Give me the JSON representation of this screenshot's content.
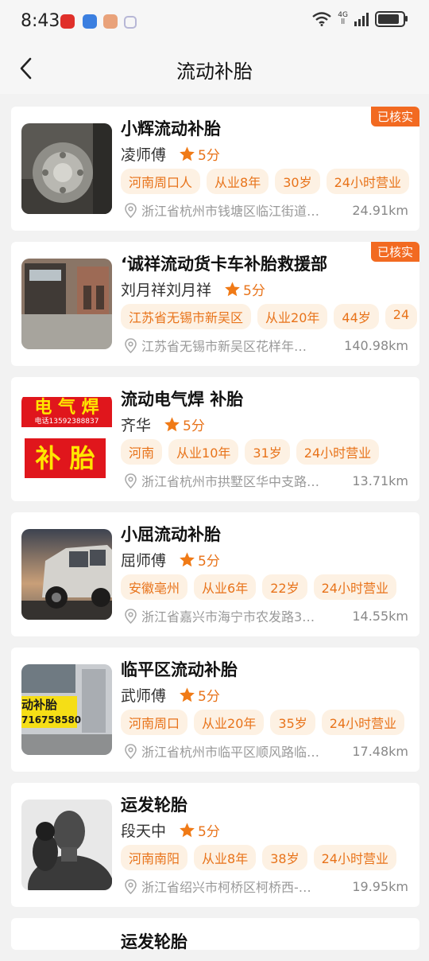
{
  "status": {
    "time": "8:43",
    "net_label_top": "4G",
    "net_label_bottom": "ll"
  },
  "header": {
    "title": "流动补胎"
  },
  "listings": [
    {
      "name": "小辉流动补胎",
      "person": "凌师傅",
      "score": "5分",
      "tags": [
        "河南周口人",
        "从业8年",
        "30岁",
        "24小时营业"
      ],
      "address": "浙江省杭州市钱塘区临江街道…",
      "distance": "24.91km",
      "badge": "已核实"
    },
    {
      "name": "‘诚祥流动货卡车补胎救援部",
      "person": "刘月祥刘月祥",
      "score": "5分",
      "tags": [
        "江苏省无锡市新吴区",
        "从业20年",
        "44岁",
        "24"
      ],
      "address": "江苏省无锡市新吴区花样年…",
      "distance": "140.98km",
      "badge": "已核实"
    },
    {
      "name": "流动电气焊 补胎",
      "person": "齐华",
      "score": "5分",
      "tags": [
        "河南",
        "从业10年",
        "31岁",
        "24小时营业"
      ],
      "address": "浙江省杭州市拱墅区华中支路…",
      "distance": "13.71km",
      "image_text": {
        "line1": "电 气 焊",
        "line2": "电话13592388837",
        "line3": "补 胎"
      }
    },
    {
      "name": "小屈流动补胎",
      "person": "屈师傅",
      "score": "5分",
      "tags": [
        "安徽亳州",
        "从业6年",
        "22岁",
        "24小时营业"
      ],
      "address": "浙江省嘉兴市海宁市农发路3…",
      "distance": "14.55km"
    },
    {
      "name": "临平区流动补胎",
      "person": "武师傅",
      "score": "5分",
      "tags": [
        "河南周口",
        "从业20年",
        "35岁",
        "24小时营业"
      ],
      "address": "浙江省杭州市临平区顺风路临…",
      "distance": "17.48km",
      "image_text": {
        "line1": "动补胎",
        "line2": "716758580"
      }
    },
    {
      "name": "运发轮胎",
      "person": "段天中",
      "score": "5分",
      "tags": [
        "河南南阳",
        "从业8年",
        "38岁",
        "24小时营业"
      ],
      "address": "浙江省绍兴市柯桥区柯桥西-…",
      "distance": "19.95km"
    }
  ],
  "partial_listing": {
    "name": "运发轮胎"
  },
  "colors": {
    "accent": "#e8731a",
    "badge": "#f26a21",
    "tag_bg": "#fdf1e3"
  },
  "icons": [
    "back-arrow-icon",
    "star-icon",
    "location-pin-icon",
    "wifi-icon",
    "signal-icon",
    "battery-icon"
  ]
}
